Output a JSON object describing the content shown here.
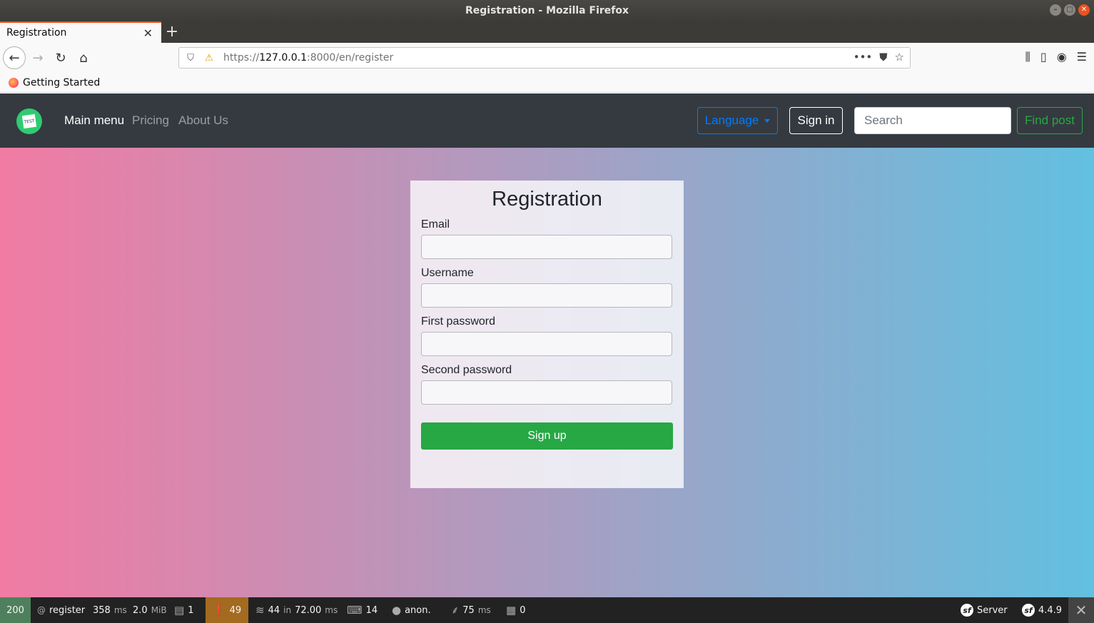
{
  "window": {
    "title": "Registration - Mozilla Firefox"
  },
  "browser": {
    "tab_title": "Registration",
    "url_scheme": "https://",
    "url_host": "127.0.0.1",
    "url_rest": ":8000/en/register",
    "bookmark": "Getting Started"
  },
  "nav": {
    "main_menu": "Main menu",
    "pricing": "Pricing",
    "about": "About Us",
    "language": "Language",
    "sign_in": "Sign in",
    "search_placeholder": "Search",
    "find_post": "Find post",
    "brand_text": "TEST"
  },
  "form": {
    "title": "Registration",
    "email_label": "Email",
    "username_label": "Username",
    "first_password_label": "First password",
    "second_password_label": "Second password",
    "submit": "Sign up"
  },
  "debug_toolbar": {
    "status": "200",
    "route": "register",
    "time_value": "358",
    "time_unit": "ms",
    "memory_value": "2.0",
    "memory_unit": "MiB",
    "logs": "1",
    "warnings": "49",
    "db_queries": "44",
    "db_in": "in",
    "db_time": "72.00",
    "db_unit": "ms",
    "translations": "14",
    "user": "anon.",
    "twig_time": "75",
    "twig_unit": "ms",
    "forms": "0",
    "server": "Server",
    "version": "4.4.9"
  },
  "colors": {
    "navbar_bg": "#343a40",
    "gradient_start": "#f17ba3",
    "gradient_end": "#62c0e0",
    "signup_button": "#28a745",
    "status_ok": "#4f805d",
    "warning": "#a46a1f"
  }
}
